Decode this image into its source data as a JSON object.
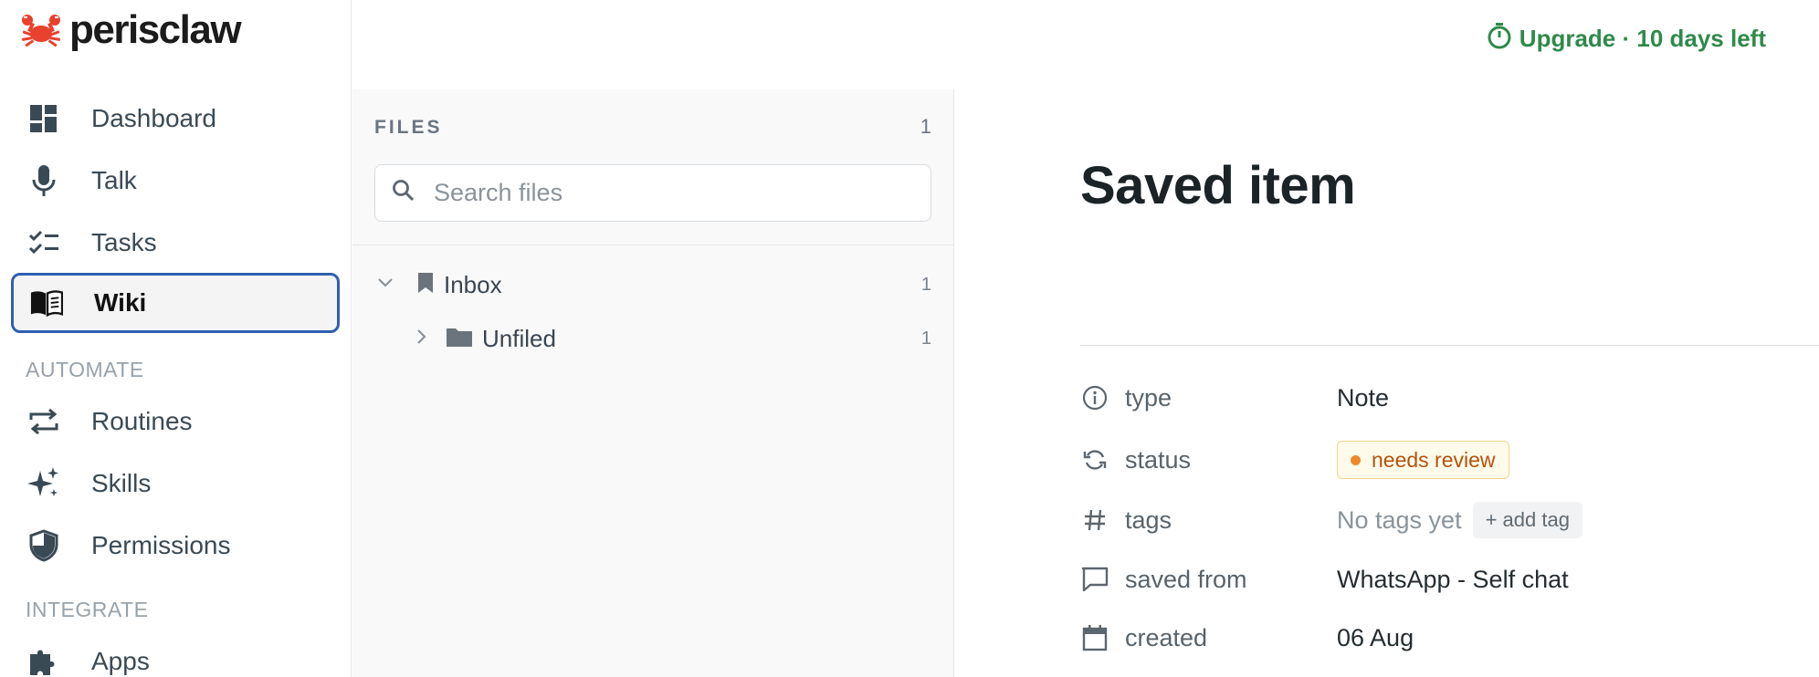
{
  "app": {
    "name": "perisclaw"
  },
  "sidebar": {
    "nav": [
      {
        "label": "Dashboard",
        "icon": "dashboard-icon"
      },
      {
        "label": "Talk",
        "icon": "microphone-icon"
      },
      {
        "label": "Tasks",
        "icon": "checklist-icon"
      },
      {
        "label": "Wiki",
        "icon": "book-icon",
        "active": true
      }
    ],
    "automate_label": "AUTOMATE",
    "automate": [
      {
        "label": "Routines",
        "icon": "repeat-icon"
      },
      {
        "label": "Skills",
        "icon": "sparkles-icon"
      },
      {
        "label": "Permissions",
        "icon": "shield-icon"
      }
    ],
    "integrate_label": "INTEGRATE",
    "integrate": [
      {
        "label": "Apps",
        "icon": "puzzle-icon"
      }
    ]
  },
  "files": {
    "title": "FILES",
    "count": "1",
    "search_placeholder": "Search files",
    "tree": [
      {
        "label": "Inbox",
        "count": "1",
        "expanded": true,
        "icon": "bookmark-icon"
      },
      {
        "label": "Unfiled",
        "count": "1",
        "expanded": false,
        "icon": "folder-icon"
      }
    ]
  },
  "header": {
    "upgrade": "Upgrade · 10 days left"
  },
  "main": {
    "title": "Saved item",
    "properties": {
      "type": {
        "key": "type",
        "value": "Note"
      },
      "status": {
        "key": "status",
        "value": "needs review"
      },
      "tags": {
        "key": "tags",
        "value": "No tags yet",
        "add": "+ add tag"
      },
      "saved_from": {
        "key": "saved from",
        "value": "WhatsApp - Self chat"
      },
      "created": {
        "key": "created",
        "value": "06 Aug"
      }
    }
  },
  "colors": {
    "accent_green": "#2f8a4a",
    "active_border": "#2f5fb0",
    "logo_red": "#e8412e",
    "status_orange": "#ec8a2b"
  }
}
